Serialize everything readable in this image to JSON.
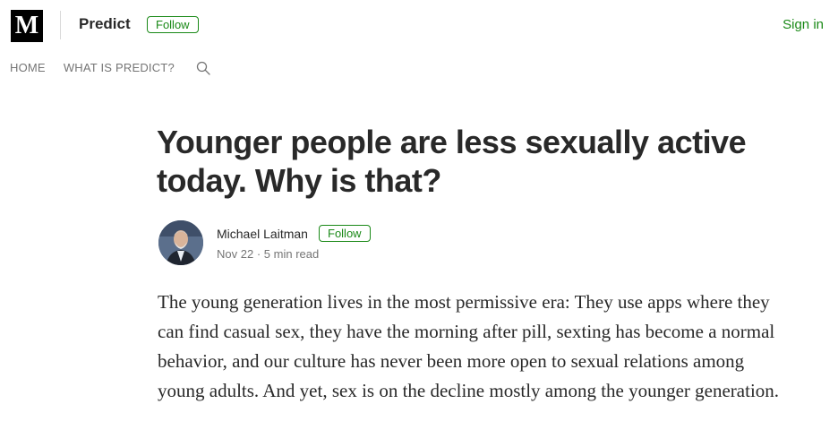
{
  "header": {
    "logo_letter": "M",
    "publication": "Predict",
    "follow_label": "Follow",
    "signin_label": "Sign in"
  },
  "nav": {
    "items": [
      "HOME",
      "WHAT IS PREDICT?"
    ],
    "search_icon": "search-icon"
  },
  "article": {
    "title": "Younger people are less sexually active today. Why is that?",
    "author": {
      "name": "Michael Laitman",
      "follow_label": "Follow",
      "date": "Nov 22",
      "separator": "·",
      "read_time": "5 min read"
    },
    "paragraph": "The young generation lives in the most permissive era: They use apps where they can find casual sex, they have the morning after pill, sexting has become a normal behavior, and our culture has never been more open to sexual relations among young adults. And yet, sex is on the decline mostly among the younger generation."
  },
  "colors": {
    "accent": "#1a8917",
    "text": "#292929",
    "muted": "#757575"
  }
}
